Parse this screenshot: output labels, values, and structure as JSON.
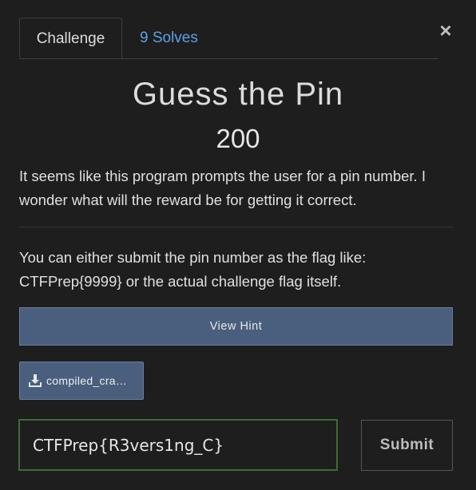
{
  "tabs": [
    {
      "label": "Challenge",
      "active": true
    },
    {
      "label": "9 Solves",
      "active": false
    }
  ],
  "close_label": "×",
  "challenge": {
    "title": "Guess the Pin",
    "points": "200",
    "description": "It seems like this program prompts the user for a pin number. I wonder what will the reward be for getting it correct.",
    "note": "You can either submit the pin number as the flag like: CTFPrep{9999} or the actual challenge flag itself."
  },
  "hint": {
    "label": "View Hint"
  },
  "file": {
    "label": "compiled_cra…",
    "icon": "download-icon"
  },
  "flag_input": {
    "value": "CTFPrep{R3vers1ng_C}"
  },
  "submit": {
    "label": "Submit"
  },
  "colors": {
    "background": "#1e1e1e",
    "link": "#5aa0e6",
    "button": "#4a5f7e",
    "input_border": "#3f6b36"
  }
}
